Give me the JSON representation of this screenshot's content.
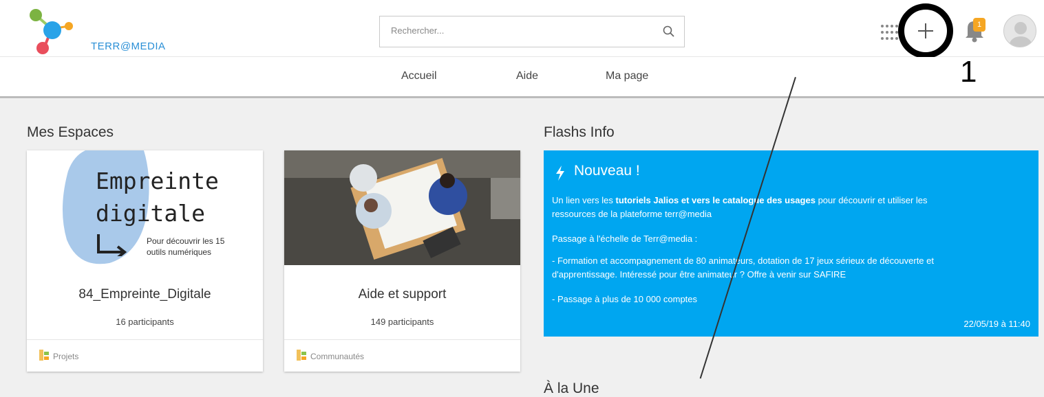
{
  "brand": {
    "name": "TERR@MEDIA"
  },
  "search": {
    "placeholder": "Rechercher..."
  },
  "notifications": {
    "count": "1"
  },
  "annotation": {
    "label": "1"
  },
  "nav": {
    "items": [
      "Accueil",
      "Aide",
      "Ma page"
    ]
  },
  "spaces": {
    "title": "Mes Espaces",
    "cards": [
      {
        "image_text": {
          "line1": "Empreinte",
          "line2": "digitale",
          "sub1": "Pour découvrir les 15",
          "sub2": "outils numériques"
        },
        "name": "84_Empreinte_Digitale",
        "participants": "16 participants",
        "category": "Projets"
      },
      {
        "name": "Aide et support",
        "participants": "149 participants",
        "category": "Communautés"
      }
    ]
  },
  "flash": {
    "section_title": "Flashs Info",
    "title": "Nouveau !",
    "p1_a": "Un lien vers les ",
    "p1_bold": "tutoriels Jalios et vers le catalogue des usages",
    "p1_b": " pour découvrir et utiliser les",
    "p1_c": "ressources de la plateforme terr@media",
    "p2": "Passage à l'échelle de Terr@media :",
    "p3_a": "- Formation et accompagnement de 80 animateurs, dotation de 17 jeux sérieux de découverte et",
    "p3_b": "d'apprentissage. Intéressé pour être animateur ? Offre à venir sur SAFIRE",
    "p4": "- Passage  à plus de 10 000 comptes",
    "date": "22/05/19 à 11:40"
  },
  "alaune": {
    "title": "À la Une"
  },
  "colors": {
    "flash_bg": "#00a6f0",
    "badge": "#f5a623",
    "logo_text": "#2a8fd6"
  }
}
